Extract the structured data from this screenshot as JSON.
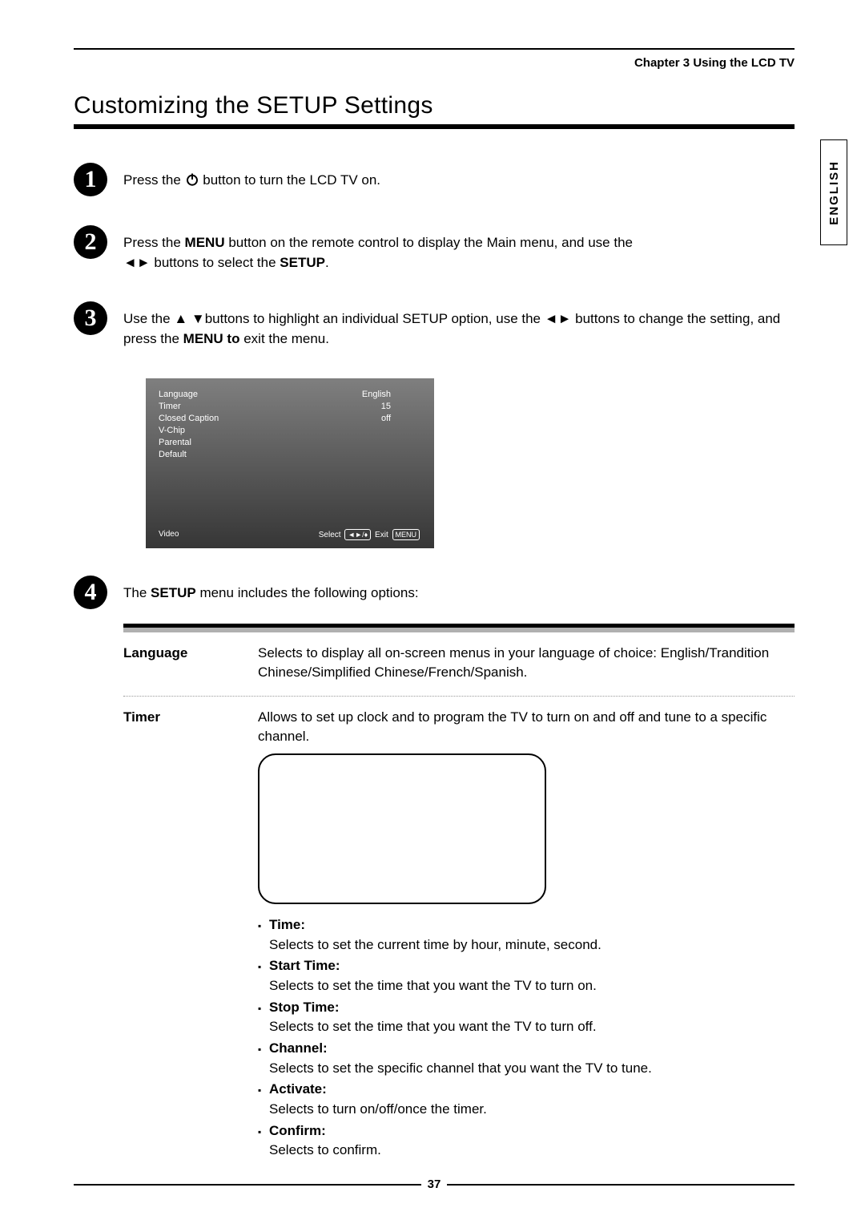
{
  "chapter": "Chapter 3 Using the LCD TV",
  "heading": "Customizing the SETUP Settings",
  "lang_tab": "ENGLISH",
  "page_number": "37",
  "steps": {
    "s1_pre": "Press the ",
    "s1_post": " button to turn the LCD TV on.",
    "s2_a": "Press the ",
    "s2_menu": "MENU",
    "s2_b": " button on the remote control to display the Main menu, and use the ",
    "s2_c": " buttons to select the ",
    "s2_setup": "SETUP",
    "s2_d": ".",
    "s3_a": "Use the  ",
    "s3_b": "buttons to highlight an individual SETUP option, use the ",
    "s3_c": " buttons to change the setting, and press the ",
    "s3_menu_to": "MENU to",
    "s3_d": " exit the menu.",
    "s4_a": "The ",
    "s4_setup": "SETUP",
    "s4_b": " menu includes the following options:"
  },
  "osd": {
    "rows": [
      {
        "label": "Language",
        "value": "English"
      },
      {
        "label": "Timer",
        "value": "15"
      },
      {
        "label": "Closed Caption",
        "value": "off"
      },
      {
        "label": "V-Chip",
        "value": ""
      },
      {
        "label": "Parental",
        "value": ""
      },
      {
        "label": "Default",
        "value": ""
      }
    ],
    "footer_left": "Video",
    "footer_select": "Select",
    "footer_arrows": "◄►/",
    "footer_exit": "Exit",
    "footer_menu": "MENU"
  },
  "table": {
    "language": {
      "term": "Language",
      "desc": "Selects to display all on-screen menus in your language of choice: English/Trandition Chinese/Simplified Chinese/French/Spanish."
    },
    "timer": {
      "term": "Timer",
      "desc": "Allows to set up clock and to program the TV to turn on and off and tune to a specific channel.",
      "items": [
        {
          "title": "Time:",
          "body": "Selects to set the current time by hour, minute, second."
        },
        {
          "title": "Start Time:",
          "body": "Selects to set the time that you want the TV to turn on."
        },
        {
          "title": "Stop Time:",
          "body": "Selects to set the time that you want the TV to turn off."
        },
        {
          "title": "Channel:",
          "body": "Selects to set the specific channel that you want the TV to tune."
        },
        {
          "title": "Activate:",
          "body": "Selects to turn on/off/once the timer."
        },
        {
          "title": "Confirm:",
          "body": "Selects to confirm."
        }
      ]
    }
  }
}
